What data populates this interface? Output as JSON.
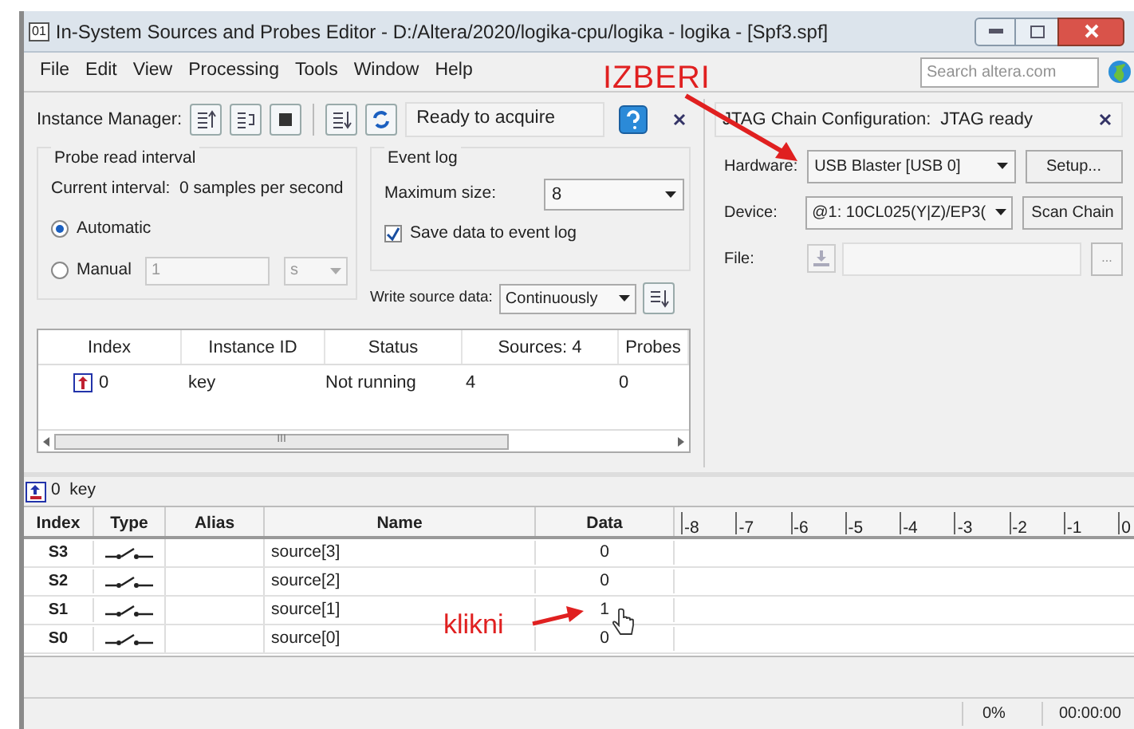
{
  "window": {
    "title": "In-System Sources and Probes Editor - D:/Altera/2020/logika-cpu/logika - logika - [Spf3.spf]",
    "app_badge": "01"
  },
  "menu": [
    "File",
    "Edit",
    "View",
    "Processing",
    "Tools",
    "Window",
    "Help"
  ],
  "search": {
    "placeholder": "Search altera.com"
  },
  "instance_manager": {
    "label": "Instance Manager:",
    "status": "Ready to acquire"
  },
  "probe_read_interval": {
    "title": "Probe read interval",
    "current_interval": "Current interval:  0 samples per second",
    "options": [
      {
        "label": "Automatic",
        "selected": true
      },
      {
        "label": "Manual",
        "selected": false
      }
    ],
    "manual_value": "1",
    "manual_unit": "s"
  },
  "event_log": {
    "title": "Event log",
    "max_size_label": "Maximum size:",
    "max_size": "8",
    "save": {
      "label": "Save data to event log",
      "checked": true
    }
  },
  "write_source_data": {
    "label": "Write source data:",
    "value": "Continuously"
  },
  "instance_table": {
    "columns": [
      "Index",
      "Instance ID",
      "Status",
      "Sources: 4",
      "Probes"
    ],
    "rows": [
      {
        "index": "0",
        "instance_id": "key",
        "status": "Not running",
        "sources": "4",
        "probes": "0"
      }
    ],
    "scroll_mark": "III"
  },
  "jtag": {
    "title": "JTAG Chain Configuration:",
    "status": "JTAG ready",
    "hardware_label": "Hardware:",
    "hardware": "USB Blaster [USB 0]",
    "setup": "Setup...",
    "device_label": "Device:",
    "device": "@1: 10CL025(Y|Z)/EP3(",
    "scan": "Scan Chain",
    "file_label": "File:",
    "browse": "..."
  },
  "instance_label": "0  key",
  "sources_table": {
    "columns": [
      "Index",
      "Type",
      "Alias",
      "Name",
      "Data"
    ],
    "ticks": [
      "-8",
      "-7",
      "-6",
      "-5",
      "-4",
      "-3",
      "-2",
      "-1",
      "0"
    ],
    "rows": [
      {
        "index": "S3",
        "name": "source[3]",
        "data": "0"
      },
      {
        "index": "S2",
        "name": "source[2]",
        "data": "0"
      },
      {
        "index": "S1",
        "name": "source[1]",
        "data": "1"
      },
      {
        "index": "S0",
        "name": "source[0]",
        "data": "0"
      }
    ]
  },
  "status_bar": {
    "progress": "0%",
    "time": "00:00:00"
  },
  "annotations": [
    {
      "kind": "izberi",
      "text": "IZBERI"
    },
    {
      "kind": "klikni",
      "text": "klikni"
    }
  ]
}
